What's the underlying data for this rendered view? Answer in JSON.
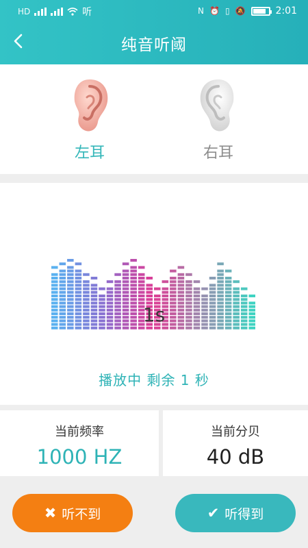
{
  "status_bar": {
    "net_label": "听",
    "time": "2:01",
    "battery_level": 0.8,
    "icons": [
      "hd-icon",
      "signal-icon",
      "wifi-icon",
      "nfc-icon",
      "alarm-icon",
      "vibrate-icon",
      "mute-icon",
      "battery-icon"
    ]
  },
  "header": {
    "title": "纯音听阈",
    "back_icon": "chevron-left-icon"
  },
  "ears": [
    {
      "label": "左耳",
      "selected": true,
      "color": "#f2b3a6"
    },
    {
      "label": "右耳",
      "selected": false,
      "color": "#e8e8e8"
    }
  ],
  "visualizer": {
    "seconds_label": "1s",
    "playing_text": "播放中 剩余 1 秒",
    "column_colors": [
      "#5ab1f0",
      "#8b6fd1",
      "#df3c94",
      "#9a8fb0",
      "#3ed3c2"
    ]
  },
  "info": {
    "frequency": {
      "title": "当前频率",
      "value": "1000 HZ"
    },
    "decibel": {
      "title": "当前分贝",
      "value": "40 dB"
    }
  },
  "buttons": {
    "cannot_hear": {
      "label": "听不到",
      "icon": "close-icon",
      "color": "#f47f12"
    },
    "can_hear": {
      "label": "听得到",
      "icon": "check-icon",
      "color": "#39b8bd"
    }
  }
}
